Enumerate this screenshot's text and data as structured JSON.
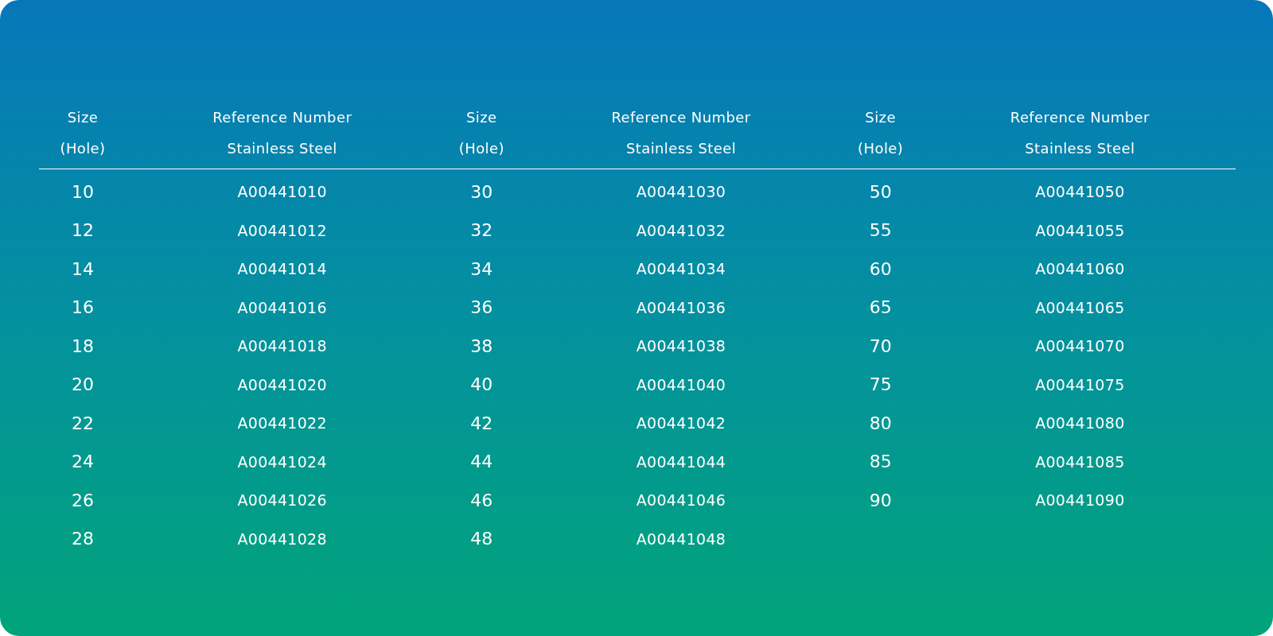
{
  "table": {
    "groups": [
      {
        "columns": [
          "Size\n(Hole)",
          "Reference Number\nStainless Steel"
        ],
        "rows": [
          [
            "10",
            "A00441010"
          ],
          [
            "12",
            "A00441012"
          ],
          [
            "14",
            "A00441014"
          ],
          [
            "16",
            "A00441016"
          ],
          [
            "18",
            "A00441018"
          ],
          [
            "20",
            "A00441020"
          ],
          [
            "22",
            "A00441022"
          ],
          [
            "24",
            "A00441024"
          ],
          [
            "26",
            "A00441026"
          ],
          [
            "28",
            "A00441028"
          ]
        ]
      },
      {
        "columns": [
          "Size\n(Hole)",
          "Reference Number\nStainless Steel"
        ],
        "rows": [
          [
            "30",
            "A00441030"
          ],
          [
            "32",
            "A00441032"
          ],
          [
            "34",
            "A00441034"
          ],
          [
            "36",
            "A00441036"
          ],
          [
            "38",
            "A00441038"
          ],
          [
            "40",
            "A00441040"
          ],
          [
            "42",
            "A00441042"
          ],
          [
            "44",
            "A00441044"
          ],
          [
            "46",
            "A00441046"
          ],
          [
            "48",
            "A00441048"
          ]
        ]
      },
      {
        "columns": [
          "Size\n(Hole)",
          "Reference Number\nStainless Steel"
        ],
        "rows": [
          [
            "50",
            "A00441050"
          ],
          [
            "55",
            "A00441055"
          ],
          [
            "60",
            "A00441060"
          ],
          [
            "65",
            "A00441065"
          ],
          [
            "70",
            "A00441070"
          ],
          [
            "75",
            "A00441075"
          ],
          [
            "80",
            "A00441080"
          ],
          [
            "85",
            "A00441085"
          ],
          [
            "90",
            "A00441090"
          ]
        ]
      }
    ]
  }
}
